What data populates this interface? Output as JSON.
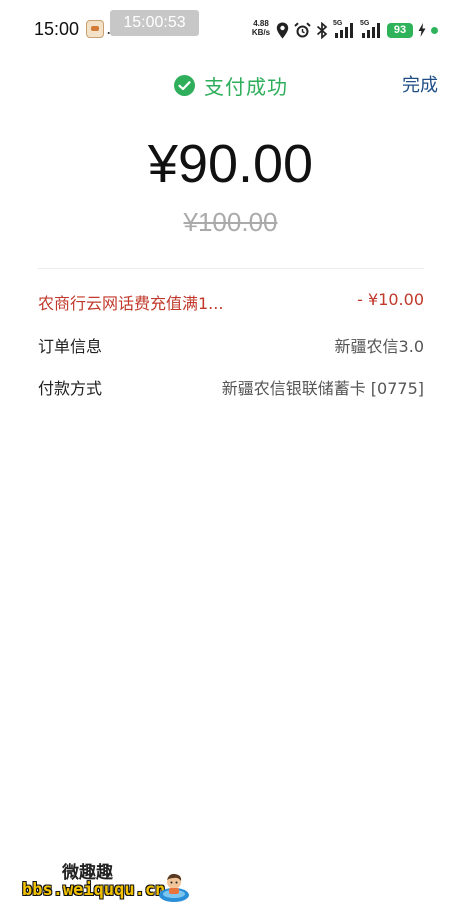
{
  "status_bar": {
    "time": "15:00",
    "overlay_time": "15:00:53",
    "net_speed_value": "4.88",
    "net_speed_unit": "KB/s",
    "sim1_label": "5G",
    "sim2_label": "5G",
    "battery": "93",
    "icons": [
      "location-icon",
      "alarm-icon",
      "bluetooth-icon",
      "signal-icon",
      "charging-icon"
    ]
  },
  "header": {
    "title": "支付成功",
    "done_label": "完成",
    "accent_color": "#2fae5b",
    "done_color": "#1f4f86"
  },
  "amount": {
    "paid": "¥90.00",
    "original": "¥100.00"
  },
  "details": {
    "discount": {
      "label": "农商行云网话费充值满1...",
      "value": "- ¥10.00",
      "color": "#c0392b"
    },
    "order_info": {
      "label": "订单信息",
      "value": "新疆农信3.0"
    },
    "payment_method": {
      "label": "付款方式",
      "value": "新疆农信银联储蓄卡 [0775]"
    }
  },
  "watermark": {
    "title": "微趣趣",
    "url": "bbs.weiququ.cn"
  }
}
